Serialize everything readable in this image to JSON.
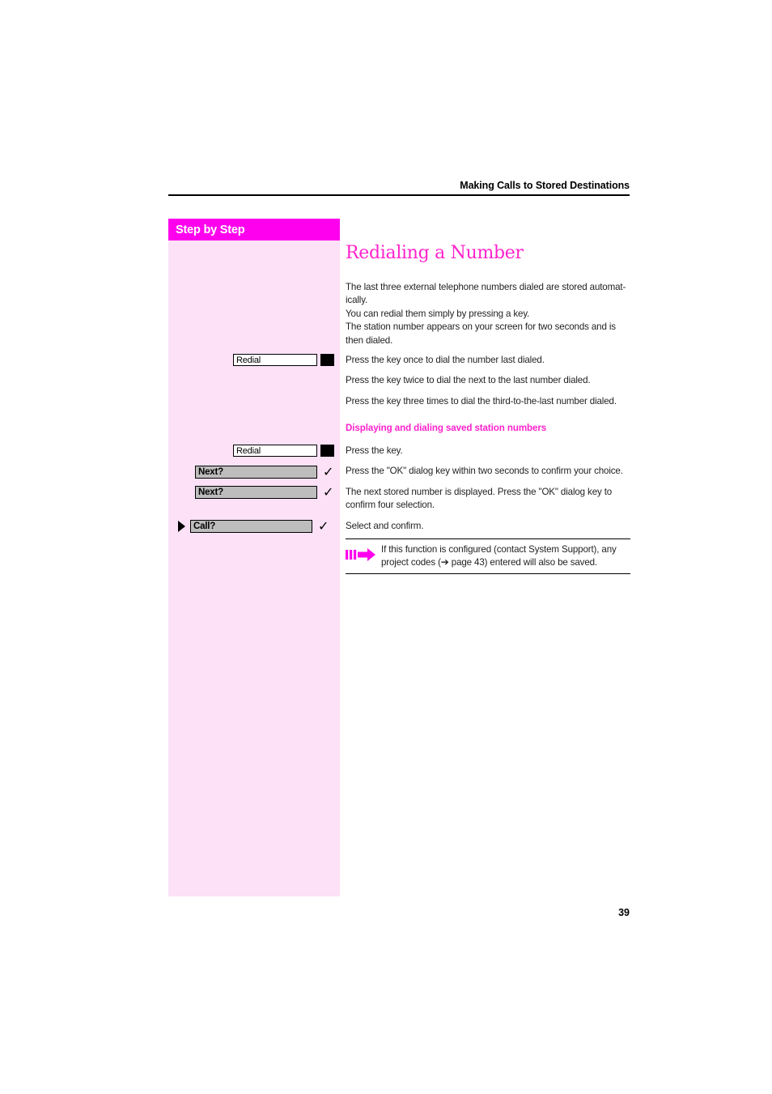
{
  "header": {
    "title": "Making Calls to Stored Destinations"
  },
  "sidebar": {
    "title": "Step by Step",
    "keys": [
      {
        "label": "Redial",
        "type": "display-key",
        "icon": "black-key-icon"
      },
      {
        "label": "Redial",
        "type": "display-key",
        "icon": "black-key-icon"
      },
      {
        "label": "Next?",
        "type": "dialog-key",
        "icon": "checkmark-icon"
      },
      {
        "label": "Next?",
        "type": "dialog-key",
        "icon": "checkmark-icon"
      },
      {
        "label": "Call?",
        "type": "dialog-key",
        "icon": "checkmark-icon",
        "marker": "select-arrow-icon"
      }
    ]
  },
  "main": {
    "heading": "Redialing a Number",
    "intro_line1": "The last three external telephone numbers dialed are stored automat-",
    "intro_line2": "ically.",
    "intro_line3": "You can redial them simply by pressing a key.",
    "intro_line4": "The station number appears on your screen for two seconds and is",
    "intro_line5": "then dialed.",
    "step_redial_once": "Press the key once to dial the number last dialed.",
    "step_redial_twice": "Press the key twice to dial the next to the last number dialed.",
    "step_redial_three": "Press the key three times to dial the third-to-the-last number dialed.",
    "subhead": "Displaying and dialing saved station numbers",
    "step_press_key": "Press the key.",
    "step_ok_two_seconds": "Press the \"OK\" dialog key within two seconds to confirm your choice.",
    "step_next_stored_line1": "The next stored number is displayed. Press the \"OK\" dialog key to",
    "step_next_stored_line2": "confirm four selection.",
    "step_select_confirm": "Select and confirm."
  },
  "note": {
    "icon": "magenta-arrow-icon",
    "text_part1": "If this function is configured (contact System Support), any",
    "text_part2": "project codes (",
    "arrow_glyph": "➔",
    "text_part3": " page 43) entered will also be saved."
  },
  "footer": {
    "page_number": "39"
  },
  "colors": {
    "accent_magenta": "#ff00ee",
    "heading_pink": "#ff22cc",
    "sidebar_bg": "#fce1f7",
    "dialog_key_gray": "#bdbdbd"
  }
}
